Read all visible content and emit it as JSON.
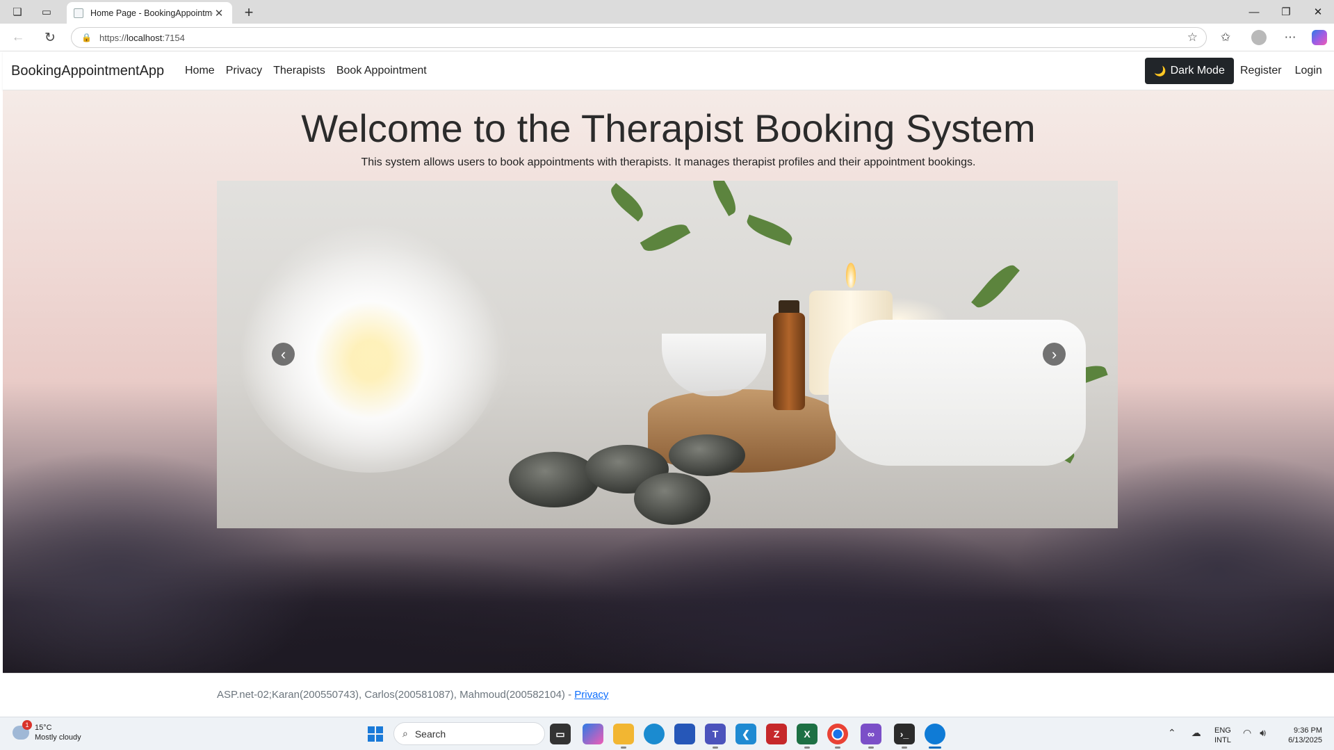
{
  "browser": {
    "tab_title": "Home Page - BookingAppointme",
    "url_prefix": "https://",
    "url_host": "localhost",
    "url_suffix": ":7154"
  },
  "navbar": {
    "brand": "BookingAppointmentApp",
    "links": [
      "Home",
      "Privacy",
      "Therapists",
      "Book Appointment"
    ],
    "dark_mode_label": "Dark Mode",
    "register": "Register",
    "login": "Login"
  },
  "hero": {
    "title": "Welcome to the Therapist Booking System",
    "subtitle": "This system allows users to book appointments with therapists. It manages therapist profiles and their appointment bookings."
  },
  "footer": {
    "text": "ASP.net-02;Karan(200550743), Carlos(200581087), Mahmoud(200582104) - ",
    "privacy_link": "Privacy"
  },
  "taskbar": {
    "weather_temp": "15°C",
    "weather_desc": "Mostly cloudy",
    "weather_badge": "1",
    "search_placeholder": "Search",
    "lang_top": "ENG",
    "lang_bottom": "INTL",
    "time": "9:36 PM",
    "date": "6/13/2025"
  },
  "colors": {
    "accent": "#0d6efd",
    "dark_button": "#212529"
  }
}
